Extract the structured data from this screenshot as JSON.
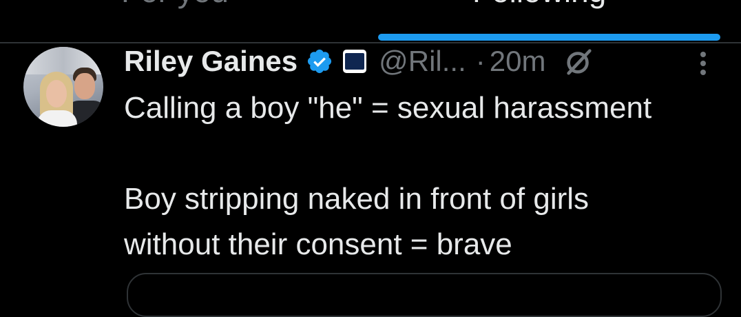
{
  "tabs": [
    {
      "label": "For you",
      "selected": false
    },
    {
      "label": "Following",
      "selected": true
    }
  ],
  "colors": {
    "accent": "#1d9bf0",
    "background": "#000000",
    "muted": "#71767b",
    "text": "#e7e9ea"
  },
  "tweet": {
    "author_name": "Riley Gaines",
    "verified_icon": "verified-badge-icon",
    "affiliation_icon": "organization-affiliation-icon",
    "handle": "@Ril...",
    "separator": "·",
    "time": "20m",
    "grok_icon": "grok-icon",
    "more_icon": "more-vertical-icon",
    "lines": [
      "Calling a boy \"he\" = sexual harassment",
      "Boy stripping naked in front of girls",
      "without their consent = brave"
    ]
  }
}
